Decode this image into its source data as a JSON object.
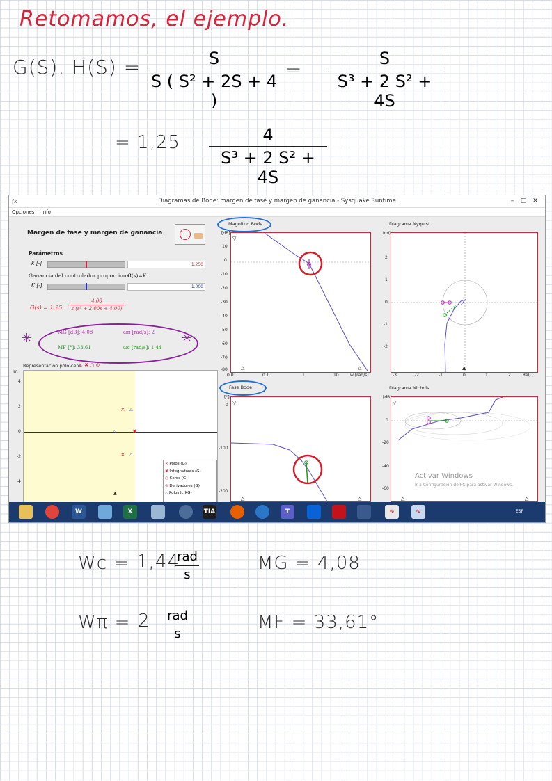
{
  "notes": {
    "heading": "Retomamos, el ejemplo.",
    "eq1_lhs": "G(S). H(S) =",
    "eq1_num": "S",
    "eq1_den": "S ( S² + 2S + 4 )",
    "eq1_eq": "=",
    "eq1_num2": "S",
    "eq1_den2": "S³ + 2 S² + 4S",
    "eq2_lhs": "=  1,25",
    "eq2_num": "4",
    "eq2_den": "S³ + 2 S² + 4S",
    "wc_label": "Wc =",
    "wc_value": "1,44",
    "wc_unit_num": "rad",
    "wc_unit_den": "s",
    "wpi_label": "Wπ =",
    "wpi_value": "2",
    "wpi_unit_num": "rad",
    "wpi_unit_den": "s",
    "mg": "MG = 4,08",
    "mf": "MF = 33,61°"
  },
  "app": {
    "title": "Diagramas de Bode: margen de fase y margen de ganancia - Sysquake Runtime",
    "menu": [
      "Opciones",
      "Info"
    ],
    "panel_title": "Margen de fase y margen de ganancia",
    "params_label": "Parámetros",
    "k_label": "k [-]",
    "k_value": "1.250",
    "controller_label": "Ganancia del controlador proporcional,",
    "controller_formula": "C(s)=K",
    "K_label": "K [-]",
    "K_value": "1.000",
    "gs_lhs": "G(s) = 1.25",
    "gs_num": "4.00",
    "gs_den": "s (s² + 2.00s + 4.00)",
    "mg_text": "MG [dB]: 4.08",
    "wpi_text": "ωπ [rad/s]: 2",
    "mf_text": "MF [°]:  33.61",
    "wc_text": "ωc [rad/s]: 1.44",
    "pz_title": "Representación polo-cero",
    "pz_y_label": "Im",
    "pz_ticks": [
      "4",
      "2",
      "0",
      "-2",
      "-4"
    ],
    "legend": [
      "Polos (G)",
      "Integradores (G)",
      "Ceros (G)",
      "Derivadores (G)",
      "Polos lc(KG)"
    ],
    "mag_title": "Magnitud Bode",
    "mag_unit": "[dB]",
    "mag_ticks": [
      "10",
      "0",
      "-10",
      "-20",
      "-30",
      "-40",
      "-50",
      "-60",
      "-70",
      "-80"
    ],
    "freq_ticks": [
      "0.01",
      "0.1",
      "1",
      "10",
      "w [rad/s]"
    ],
    "phase_title": "Fase Bode",
    "phase_unit": "[°]",
    "phase_ticks": [
      "0",
      "-100",
      "-200"
    ],
    "nyq_title": "Diagrama Nyquist",
    "nyq_ylabel": "Im(L)",
    "nyq_yticks": [
      "2",
      "1",
      "0",
      "-1",
      "-2"
    ],
    "nyq_xticks": [
      "-3",
      "-2",
      "-1",
      "0",
      "1",
      "2",
      "Re(L)"
    ],
    "nic_title": "Diagrama Nichols",
    "nic_unit": "[dB]",
    "nic_yticks": [
      "0",
      "-20",
      "-40",
      "-60"
    ],
    "watermark1": "Activar Windows",
    "watermark2": "Ir a Configuración de PC para activar Windows.",
    "tray_text": "ESP"
  },
  "colors": {
    "accent_red": "#d8243a",
    "annot_blue": "#1e6fd9",
    "annot_purple": "#8a1f9c",
    "curve": "#5b4fc7"
  }
}
